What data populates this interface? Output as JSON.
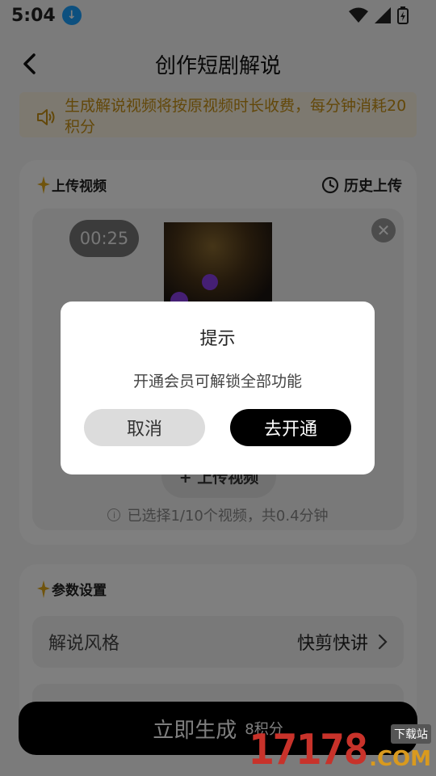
{
  "status_bar": {
    "time": "5:04"
  },
  "header": {
    "title": "创作短剧解说"
  },
  "notice": {
    "text": "生成解说视频将按原视频时长收费，每分钟消耗20积分"
  },
  "upload_section": {
    "title": "上传视频",
    "history_label": "历史上传",
    "video_duration": "00:25",
    "upload_button_label": "+ 上传视频",
    "selection_info": "已选择1/10个视频，共0.4分钟"
  },
  "params_section": {
    "title": "参数设置",
    "rows": [
      {
        "label": "解说风格",
        "value": "快剪快讲"
      }
    ]
  },
  "generate_button": {
    "label": "立即生成",
    "cost": "8积分"
  },
  "dialog": {
    "title": "提示",
    "message": "开通会员可解锁全部功能",
    "cancel_label": "取消",
    "confirm_label": "去开通"
  },
  "watermark": {
    "number": "17178",
    "domain": ".COM",
    "tag": "下载站"
  },
  "colors": {
    "accent_gold": "#c79015",
    "notice_bg": "#fbf3e0",
    "primary_button": "#000000",
    "download_badge": "#1aa0ff"
  }
}
